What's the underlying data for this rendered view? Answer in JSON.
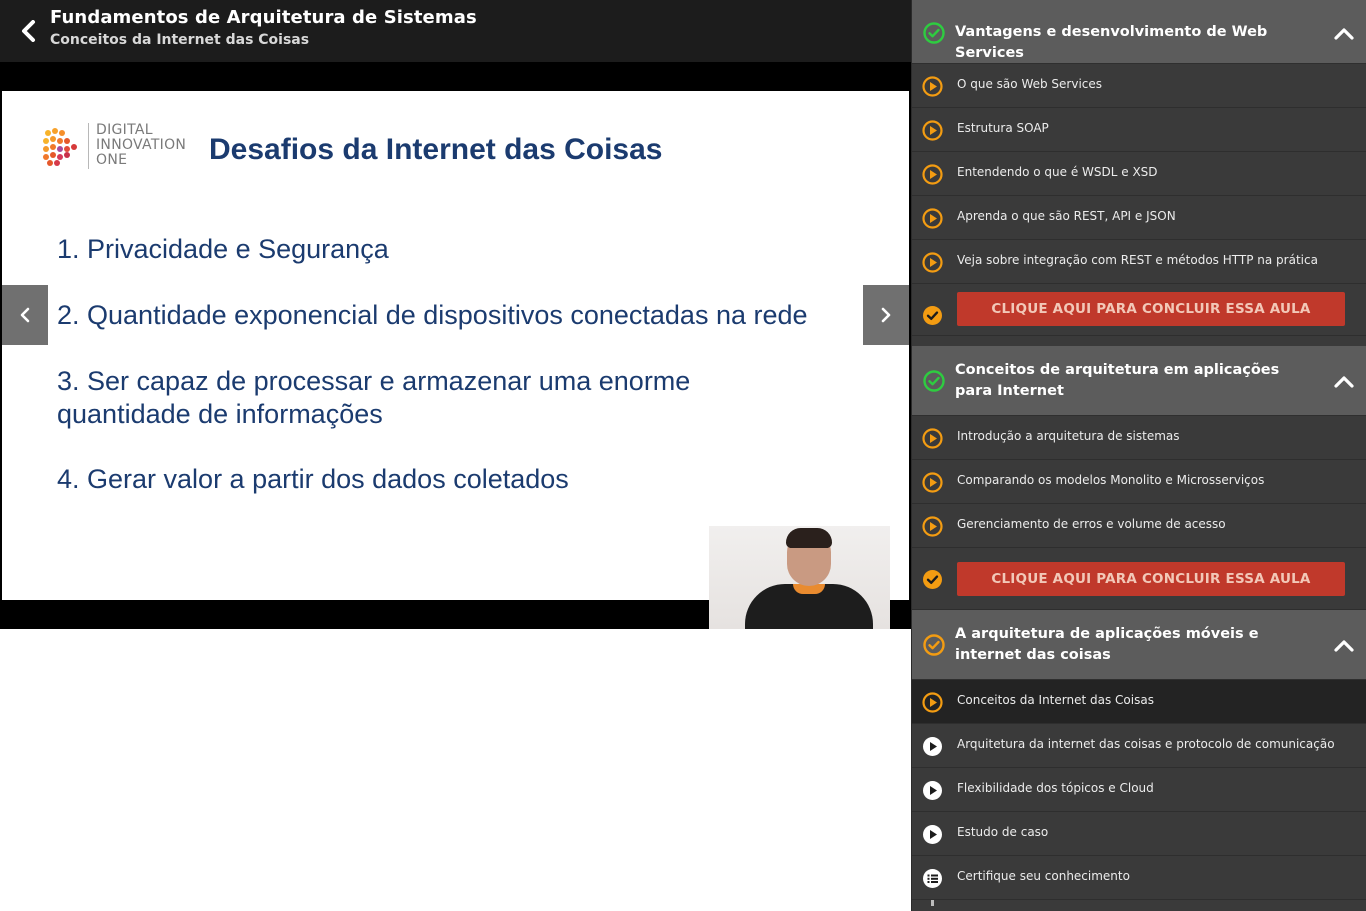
{
  "header": {
    "title": "Fundamentos de Arquitetura de Sistemas",
    "subtitle": "Conceitos da Internet das Coisas"
  },
  "slide": {
    "logo_lines": [
      "DIGITAL",
      "INNOVATION",
      "ONE"
    ],
    "title": "Desafios da Internet das Coisas",
    "items": [
      "1. Privacidade e Segurança",
      "2. Quantidade exponencial de dispositivos conectadas na rede",
      "3. Ser capaz de processar e armazenar uma enorme",
      "quantidade de informações",
      "4. Gerar valor a partir dos dados coletados"
    ]
  },
  "sidebar": {
    "sections": [
      {
        "title": "Vantagens e desenvolvimento de Web Services",
        "status": "completed",
        "lessons": [
          "O que são Web Services",
          "Estrutura SOAP",
          "Entendendo o que é WSDL e XSD",
          "Aprenda o que são REST, API e JSON",
          "Veja sobre integração com REST e métodos HTTP na prática"
        ],
        "conclude_label": "CLIQUE AQUI PARA CONCLUIR ESSA AULA"
      },
      {
        "title": "Conceitos de arquitetura em aplicações para Internet",
        "status": "completed",
        "lessons": [
          "Introdução a arquitetura de sistemas",
          "Comparando os modelos Monolito e Microsserviços",
          "Gerenciamento de erros e volume de acesso"
        ],
        "conclude_label": "CLIQUE AQUI PARA CONCLUIR ESSA AULA"
      },
      {
        "title": "A arquitetura de aplicações móveis e internet das coisas",
        "status": "in-progress",
        "lessons": [
          "Conceitos da Internet das Coisas",
          "Arquitetura da internet das coisas e protocolo de comunicação",
          "Flexibilidade dos tópicos e Cloud",
          "Estudo de caso",
          "Certifique seu conhecimento"
        ]
      }
    ]
  },
  "colors": {
    "accent_orange": "#f39c12",
    "check_green": "#2ecc40",
    "conclude_red": "#c0392b"
  }
}
